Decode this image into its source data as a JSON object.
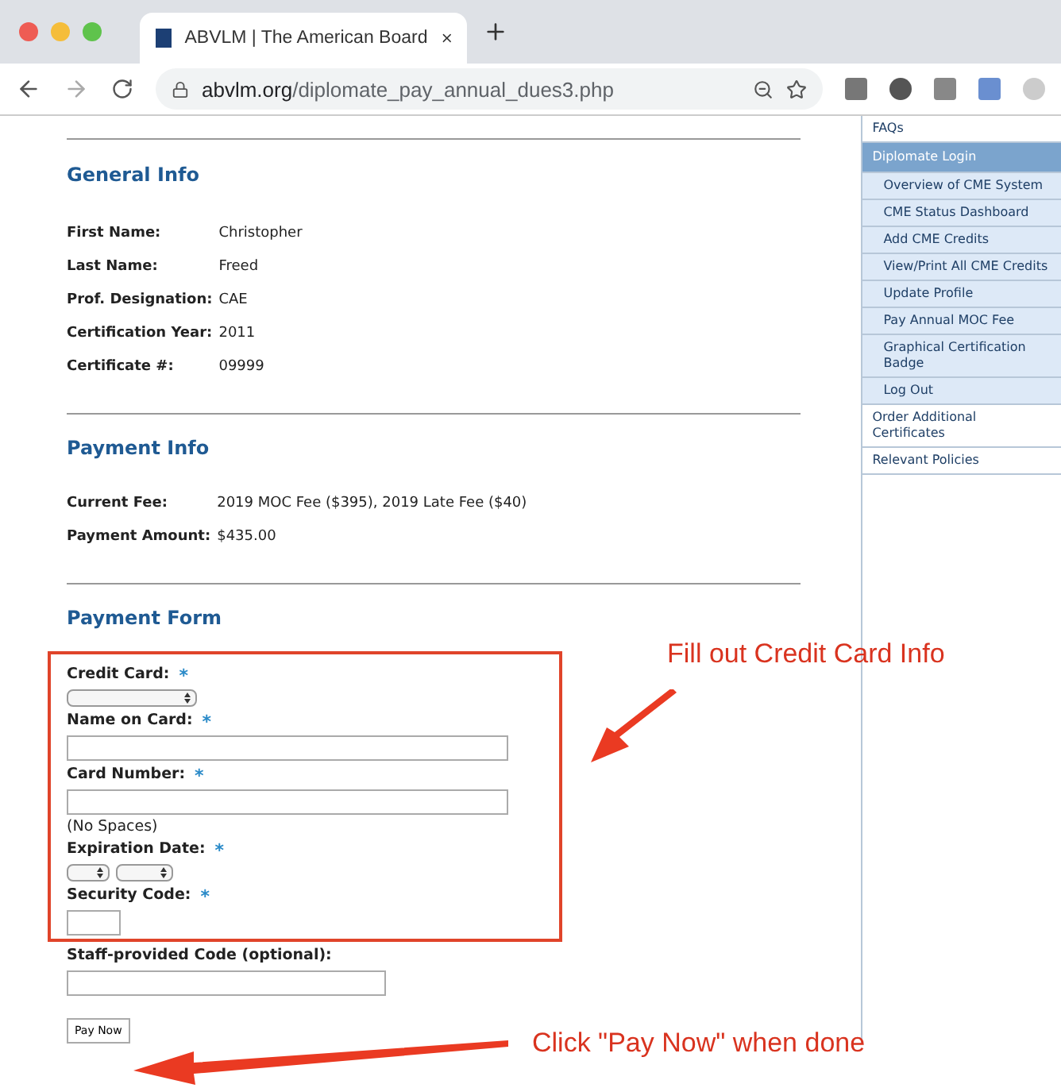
{
  "browser": {
    "tab_title": "ABVLM | The American Board",
    "url_domain": "abvlm.org",
    "url_path": "/diplomate_pay_annual_dues3.php"
  },
  "sidebar": {
    "items": [
      {
        "label": "FAQs",
        "kind": "link"
      },
      {
        "label": "Diplomate Login",
        "kind": "header"
      },
      {
        "label": "Overview of CME System",
        "kind": "sub"
      },
      {
        "label": "CME Status Dashboard",
        "kind": "sub"
      },
      {
        "label": "Add CME Credits",
        "kind": "sub"
      },
      {
        "label": "View/Print All CME Credits",
        "kind": "sub"
      },
      {
        "label": "Update Profile",
        "kind": "sub"
      },
      {
        "label": "Pay Annual MOC Fee",
        "kind": "sub"
      },
      {
        "label": "Graphical Certification Badge",
        "kind": "sub"
      },
      {
        "label": "Log Out",
        "kind": "sub"
      },
      {
        "label": "Order Additional Certificates",
        "kind": "link"
      },
      {
        "label": "Relevant Policies",
        "kind": "link"
      }
    ]
  },
  "general_info": {
    "title": "General Info",
    "fields": [
      {
        "label": "First Name:",
        "value": "Christopher"
      },
      {
        "label": "Last Name:",
        "value": "Freed"
      },
      {
        "label": "Prof. Designation:",
        "value": "CAE"
      },
      {
        "label": "Certification Year:",
        "value": "2011"
      },
      {
        "label": "Certificate #:",
        "value": "09999"
      }
    ]
  },
  "payment_info": {
    "title": "Payment Info",
    "fields": [
      {
        "label": "Current Fee:",
        "value": "2019 MOC Fee ($395), 2019 Late Fee ($40)"
      },
      {
        "label": "Payment Amount:",
        "value": "$435.00"
      }
    ]
  },
  "payment_form": {
    "title": "Payment Form",
    "highlighted_fields": [
      {
        "label": "Credit Card:",
        "mark": "*",
        "kind": "select"
      },
      {
        "label": "Name on Card:",
        "mark": "*",
        "kind": "text"
      },
      {
        "label": "Card Number:",
        "mark": "*",
        "kind": "text",
        "note": "(No Spaces)"
      },
      {
        "label": "Expiration Date:",
        "mark": "*",
        "kind": "select-pair"
      },
      {
        "label": "Security Code:",
        "mark": "*",
        "kind": "short-text"
      }
    ],
    "other_fields": [
      {
        "label": "Staff-provided Code (optional):",
        "kind": "medium-text"
      }
    ],
    "button": "Pay Now"
  },
  "annotations": [
    {
      "text": "Fill out Credit Card Info",
      "kind": "frame-callout"
    },
    {
      "text": "Click \"Pay Now\" when done",
      "kind": "button-callout"
    }
  ]
}
